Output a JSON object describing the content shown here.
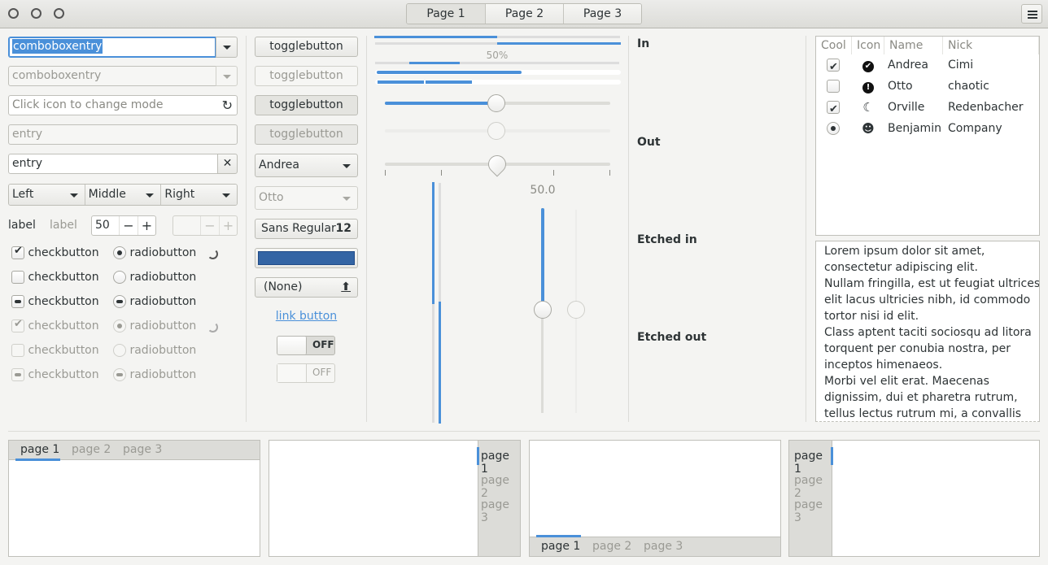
{
  "header": {
    "stack_tabs": [
      "Page 1",
      "Page 2",
      "Page 3"
    ],
    "menu_icon": "hamburger-menu-icon",
    "window_controls": [
      "close",
      "minimize",
      "maximize"
    ]
  },
  "col1": {
    "combo_entry_1": "comboboxentry",
    "combo_entry_2": "comboboxentry",
    "mode_entry_placeholder": "Click icon to change mode",
    "entry_disabled": "entry",
    "entry_clear": "entry",
    "segmented": [
      "Left",
      "Middle",
      "Right"
    ],
    "label_1": "label",
    "label_2": "label",
    "spin_value": "50",
    "spin_minus": "−",
    "spin_plus": "+",
    "checks": [
      {
        "label": "checkbutton",
        "state": "checked"
      },
      {
        "label": "checkbutton",
        "state": "unchecked"
      },
      {
        "label": "checkbutton",
        "state": "mixed"
      },
      {
        "label": "checkbutton",
        "state": "checked-disabled"
      },
      {
        "label": "checkbutton",
        "state": "unchecked-disabled"
      },
      {
        "label": "checkbutton",
        "state": "mixed-disabled"
      }
    ],
    "radios": [
      {
        "label": "radiobutton",
        "state": "checked"
      },
      {
        "label": "radiobutton",
        "state": "unchecked"
      },
      {
        "label": "radiobutton",
        "state": "mixed"
      },
      {
        "label": "radiobutton",
        "state": "checked-disabled"
      },
      {
        "label": "radiobutton",
        "state": "unchecked-disabled"
      },
      {
        "label": "radiobutton",
        "state": "mixed-disabled"
      }
    ]
  },
  "col2": {
    "toggle_1": "togglebutton",
    "toggle_2": "togglebutton",
    "toggle_3": "togglebutton",
    "toggle_4": "togglebutton",
    "combo_1": "Andrea",
    "combo_2": "Otto",
    "font_name": "Sans Regular",
    "font_size": "12",
    "color_swatch": "#3465a4",
    "file_chooser": "(None)",
    "link": "link button",
    "switch_1": "OFF",
    "switch_2": "OFF"
  },
  "col3": {
    "progress_label": "50%",
    "progress_1": 0.5,
    "progress_2": 0.5,
    "hscale_value": 0.5,
    "vscale_label": "50.0",
    "vscale_value": 0.5
  },
  "frames": [
    "In",
    "Out",
    "Etched in",
    "Etched out"
  ],
  "treeview": {
    "columns": [
      "Cool",
      "Icon",
      "Name",
      "Nick"
    ],
    "rows": [
      {
        "cool": "checked",
        "icon": "check-circle-icon",
        "name": "Andrea",
        "nick": "Cimi"
      },
      {
        "cool": "unchecked",
        "icon": "exclamation-circle-icon",
        "name": "Otto",
        "nick": "chaotic"
      },
      {
        "cool": "checked",
        "icon": "moon-icon",
        "name": "Orville",
        "nick": "Redenbacher"
      },
      {
        "cool": "radio",
        "icon": "face-monkey-icon",
        "name": "Benjamin",
        "nick": "Company"
      }
    ]
  },
  "textview": {
    "lines": [
      "Lorem ipsum dolor sit amet,",
      "consectetur adipiscing elit.",
      "Nullam fringilla, est ut feugiat ultrices,",
      "elit lacus ultricies nibh, id commodo",
      "tortor nisi id elit.",
      "Class aptent taciti sociosqu ad litora",
      "torquent per conubia nostra, per",
      "inceptos himenaeos.",
      "Morbi vel elit erat. Maecenas",
      "dignissim, dui et pharetra rutrum,",
      "tellus lectus rutrum mi, a convallis"
    ]
  },
  "notebooks": {
    "tabs": [
      "page 1",
      "page 2",
      "page 3"
    ]
  },
  "accent": "#4a90d9"
}
